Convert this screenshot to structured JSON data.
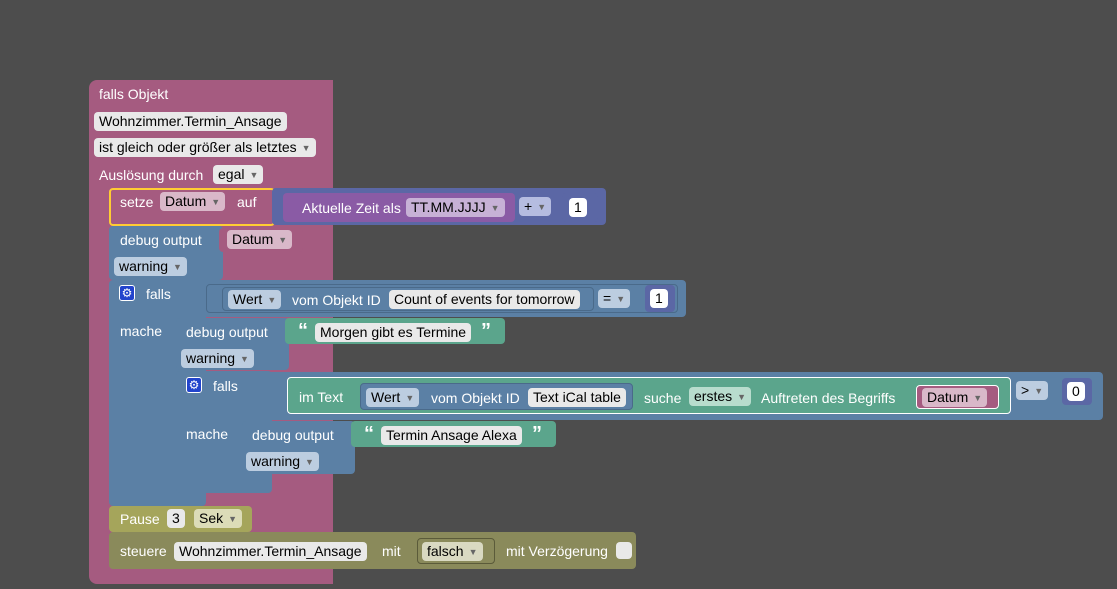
{
  "trigger": {
    "header": "falls Objekt",
    "object_id": "Wohnzimmer.Termin_Ansage",
    "condition": "ist gleich oder größer als letztes",
    "ack_label": "Auslösung durch",
    "ack_value": "egal"
  },
  "set_var": {
    "label": "setze",
    "var": "Datum",
    "to_label": "auf",
    "time_label": "Aktuelle Zeit als",
    "time_format": "TT.MM.JJJJ",
    "op": "+",
    "amount": "1"
  },
  "debug1": {
    "label": "debug output",
    "var": "Datum",
    "level": "warning"
  },
  "if1": {
    "label": "falls",
    "do_label": "mache",
    "prop": "Wert",
    "from_label": "vom Objekt ID",
    "object": "Count of events for tomorrow",
    "op": "=",
    "value": "1"
  },
  "debug2": {
    "label": "debug output",
    "text": "Morgen gibt es Termine",
    "level": "warning"
  },
  "if2": {
    "label": "falls",
    "do_label": "mache",
    "in_text_label": "im Text",
    "prop": "Wert",
    "from_label": "vom Objekt ID",
    "object": "Text iCal table",
    "search_label": "suche",
    "occurrence": "erstes",
    "occurrence_label": "Auftreten des Begriffs",
    "term": "Datum",
    "op": ">",
    "value": "0"
  },
  "debug3": {
    "label": "debug output",
    "text": "Termin Ansage Alexa",
    "level": "warning"
  },
  "pause": {
    "label": "Pause",
    "value": "3",
    "unit": "Sek"
  },
  "control": {
    "label": "steuere",
    "object": "Wohnzimmer.Termin_Ansage",
    "with_label": "mit",
    "value": "falsch",
    "delay_label": "mit Verzögerung"
  },
  "colors": {
    "background": "#4d4d4d",
    "trigger_block": "#a55b80",
    "system_block": "#5b80a5",
    "variable_block": "#a55b80",
    "time_block": "#5b67a5",
    "logic_block": "#5b80a5",
    "text_block": "#5ba58c",
    "timeout_block": "#a5a55b",
    "action_block": "#8a8a5b",
    "highlight": "#fc3"
  }
}
